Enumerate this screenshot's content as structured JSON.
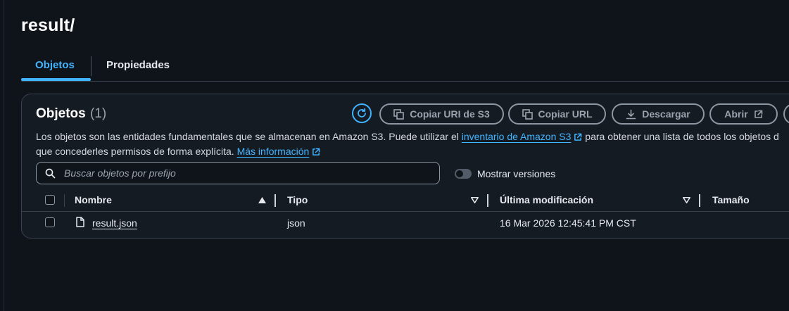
{
  "page": {
    "title": "result/"
  },
  "tabs": [
    {
      "label": "Objetos",
      "active": true
    },
    {
      "label": "Propiedades",
      "active": false
    }
  ],
  "objects_panel": {
    "heading": "Objetos",
    "count": "(1)",
    "actions": {
      "refresh_icon": "refresh-icon",
      "copy_uri": "Copiar URI de S3",
      "copy_url": "Copiar URL",
      "download": "Descargar",
      "open": "Abrir"
    },
    "description": {
      "line1_prefix": "Los objetos son las entidades fundamentales que se almacenan en Amazon S3. Puede utilizar el",
      "inventory_link": "inventario de Amazon S3",
      "line1_suffix": "para obtener una lista de todos los objetos d",
      "line2_prefix": "que concederles permisos de forma explícita.",
      "more_info_link": "Más información"
    },
    "search": {
      "placeholder": "Buscar objetos por prefijo",
      "value": ""
    },
    "show_versions": {
      "label": "Mostrar versiones",
      "on": false
    },
    "table": {
      "columns": [
        "Nombre",
        "Tipo",
        "Última modificación",
        "Tamaño"
      ],
      "rows": [
        {
          "name": "result.json",
          "type": "json",
          "modified": "16 Mar 2026 12:45:41 PM CST",
          "size": ""
        }
      ]
    }
  },
  "colors": {
    "accent": "#42b4ff",
    "background": "#0f141a",
    "panel": "#151b23"
  }
}
